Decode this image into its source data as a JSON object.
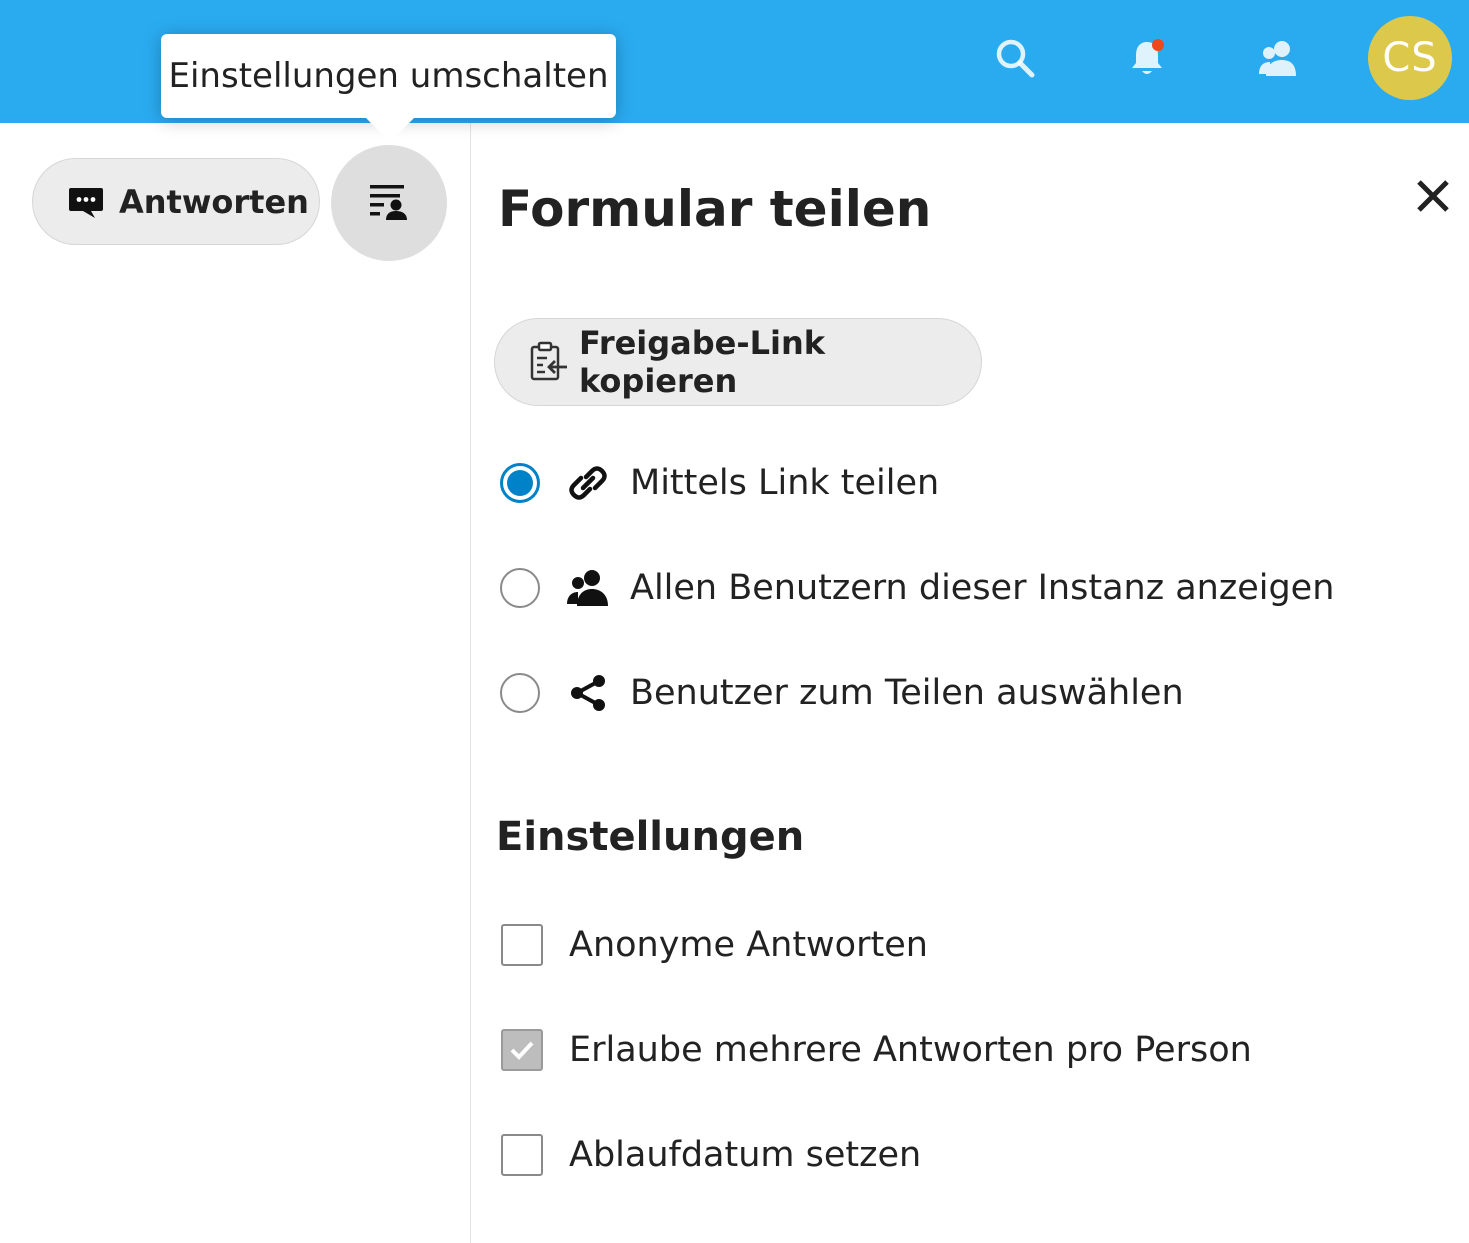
{
  "header": {
    "icons": [
      "search-icon",
      "notifications-icon",
      "contacts-icon"
    ],
    "notification_dot_color": "#f0471d",
    "avatar_initials": "CS",
    "avatar_color": "#dcc94c",
    "bar_color": "#2aabf0"
  },
  "tooltip": {
    "text": "Einstellungen umschalten"
  },
  "toolbar": {
    "responses_label": "Antworten",
    "toggle_icon": "settings-share-icon"
  },
  "sidebar": {
    "title": "Formular teilen",
    "copy_link_label": "Freigabe-Link kopieren",
    "share_options": [
      {
        "label": "Mittels Link teilen",
        "icon": "link-icon",
        "selected": true
      },
      {
        "label": "Allen Benutzern dieser Instanz anzeigen",
        "icon": "users-icon",
        "selected": false
      },
      {
        "label": "Benutzer zum Teilen auswählen",
        "icon": "share-icon",
        "selected": false
      }
    ],
    "settings_title": "Einstellungen",
    "settings": [
      {
        "label": "Anonyme Antworten",
        "checked": false
      },
      {
        "label": "Erlaube mehrere Antworten pro Person",
        "checked": true
      },
      {
        "label": "Ablaufdatum setzen",
        "checked": false
      }
    ],
    "accent_color": "#0082c9"
  }
}
